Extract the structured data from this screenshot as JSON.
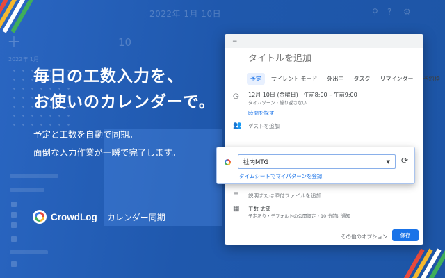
{
  "background": {
    "date_header": "2022年 1月 10日",
    "day_number": "10",
    "mini_month": "2022年 1月"
  },
  "headline": {
    "line1": "毎日の工数入力を、",
    "line2": "お使いのカレンダーで。"
  },
  "subtext": {
    "line1": "予定と工数を自動で同期。",
    "line2": "面倒な入力作業が一瞬で完了します。"
  },
  "brand": {
    "name": "CrowdLog",
    "product": "カレンダー同期"
  },
  "event_dialog": {
    "title_placeholder": "タイトルを追加",
    "tabs": [
      {
        "label": "予定"
      },
      {
        "label": "サイレント モード"
      },
      {
        "label": "外出中"
      },
      {
        "label": "タスク"
      },
      {
        "label": "リマインダー"
      },
      {
        "label": "予約枠"
      }
    ],
    "datetime": "12月 10日 (金曜日)　午前8:00 – 午前9:00",
    "timezone": "タイムゾーン・繰り返さない",
    "find_time": "時間を探す",
    "add_guests": "ゲストを追加",
    "description": "説明または添付ファイルを追加",
    "owner_name": "工数 太郎",
    "owner_sub": "予定あり・デフォルトの公開設定・10 分前に通知",
    "more_options": "その他のオプション",
    "save": "保存"
  },
  "crowdlog_card": {
    "selected_project": "社内MTG",
    "register_link": "タイムシートでマイパターンを登録"
  },
  "colors": {
    "background": "#1f58ad",
    "accent_blue": "#1a73e8",
    "stripe_colors": [
      "#e84a3d",
      "#f5b82e",
      "#3fae5a",
      "#ffffff"
    ]
  }
}
